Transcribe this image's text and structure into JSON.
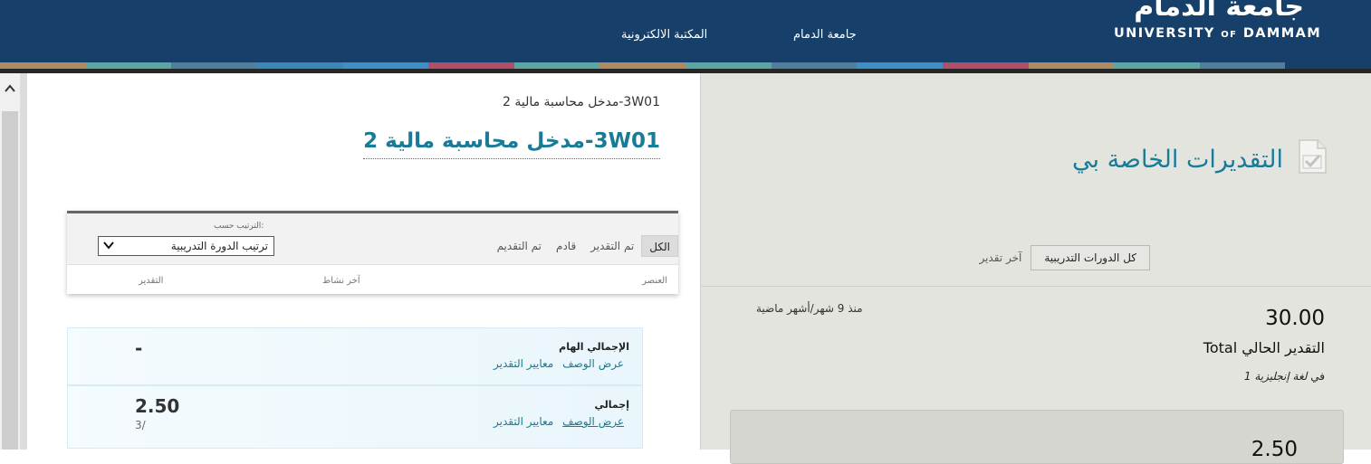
{
  "header": {
    "logo_arabic": "جامعة الدمام",
    "logo_english_1": "UNIVERSITY",
    "logo_english_of": "OF",
    "logo_english_2": "DAMMAM",
    "nav": {
      "university": "جامعة الدمام",
      "elibrary": "المكتبة الالكترونية"
    },
    "strip_colors": [
      "#b08a60",
      "#5aa6a0",
      "#4f7f9a",
      "#3d86b8",
      "#3e8fc8",
      "#b14f68",
      "#5aa6a0",
      "#b08a60",
      "#5aa6a0",
      "#4f7f9a",
      "#3e8fc8",
      "#b14f68",
      "#b08a60",
      "#5aa6a0",
      "#4f7f9a",
      "#163f6a"
    ]
  },
  "course": {
    "breadcrumb": "3W01-مدخل محاسبة مالية 2",
    "title": "3W01-مدخل محاسبة مالية 2"
  },
  "filters": {
    "tabs": [
      "الكل",
      "تم التقدير",
      "قادم",
      "تم التقديم"
    ],
    "sort_label": "الترتيب حسب:",
    "sort_value": "ترتيب الدورة التدريبية"
  },
  "columns": {
    "item": "العنصر",
    "last_activity": "آخر نشاط",
    "grade": "التقدير"
  },
  "rows": [
    {
      "title": "الإجمالي الهام",
      "link_desc": "عرض الوصف",
      "link_rubric": "معايير التقدير",
      "grade": "-",
      "out_of": ""
    },
    {
      "title": "إجمالي",
      "link_desc": "عرض الوصف",
      "link_rubric": "معايير التقدير",
      "grade": "2.50",
      "out_of": "3/"
    }
  ],
  "right": {
    "page_title": "التقديرات الخاصة بي",
    "tab_all": "كل الدورات التدريبية",
    "tab_last": "آخر تقدير",
    "ago": "منذ 9 شهر/أشهر ماضية",
    "score": "30.00",
    "score_label": "التقدير الحالي Total",
    "in_prefix": "في",
    "in_course": "لغة إنجليزية 1",
    "next_score": "2.50"
  },
  "colors": {
    "header_bg": "#163f6a",
    "accent_teal": "#1a7b97",
    "right_bg": "#e4e4df"
  }
}
